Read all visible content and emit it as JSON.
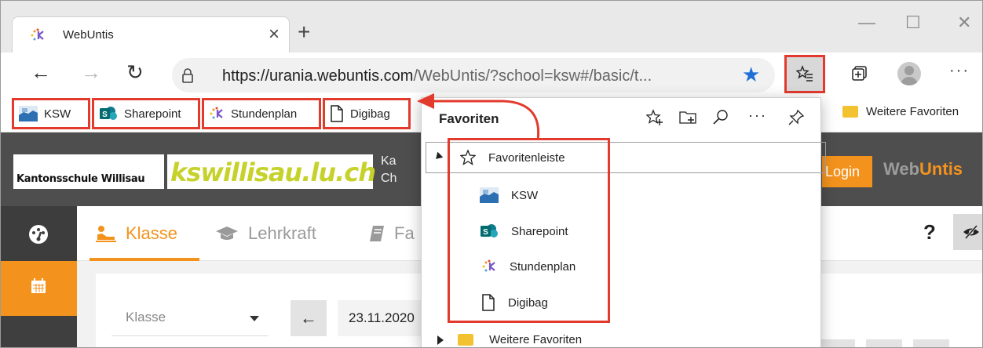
{
  "browser": {
    "tab_title": "WebUntis",
    "tab_close": "×",
    "new_tab": "+",
    "window_controls": [
      "—",
      "☐",
      "✕"
    ],
    "back": "←",
    "forward": "→",
    "refresh": "↻",
    "url_host": "https://urania.webuntis.com",
    "url_path": "/WebUntis/?school=ksw#/basic/t...",
    "bookmark_star": "★",
    "more": "···"
  },
  "favorites_bar": {
    "items": [
      {
        "label": "KSW",
        "icon": "ksw-icon"
      },
      {
        "label": "Sharepoint",
        "icon": "sharepoint-icon"
      },
      {
        "label": "Stundenplan",
        "icon": "webuntis-icon"
      },
      {
        "label": "Digibag",
        "icon": "page-icon"
      }
    ],
    "more_label": "Weitere Favoriten"
  },
  "favorites_panel": {
    "title": "Favoriten",
    "more": "···",
    "root_label": "Favoritenleiste",
    "children": [
      {
        "label": "KSW",
        "icon": "ksw-icon"
      },
      {
        "label": "Sharepoint",
        "icon": "sharepoint-icon"
      },
      {
        "label": "Stundenplan",
        "icon": "webuntis-icon"
      },
      {
        "label": "Digibag",
        "icon": "page-icon"
      }
    ],
    "other_folder": "Weitere Favoriten"
  },
  "page": {
    "logo_left": "Kantonsschule Willisau",
    "logo_right": "kswillisau.lu.ch",
    "school_line1": "Ka",
    "school_line2": "Ch",
    "login": "Login",
    "brand_web": "Web",
    "brand_untis": "Untis",
    "tabs": [
      "Klasse",
      "Lehrkraft",
      "Fa"
    ],
    "help": "?",
    "select_label": "Klasse",
    "prev_arrow": "←",
    "date": "23.11.2020"
  },
  "colors": {
    "highlight": "#e23b2e",
    "webuntis_orange": "#f3931d",
    "edge_blue": "#1f6fd6"
  }
}
